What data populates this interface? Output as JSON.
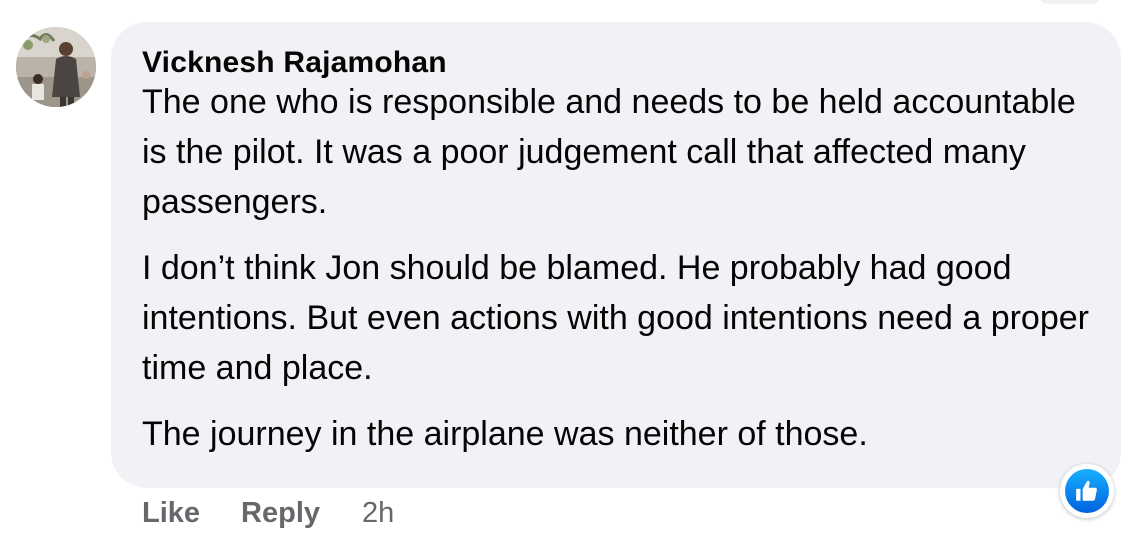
{
  "comment": {
    "author": "Vicknesh Rajamohan",
    "paragraphs": [
      "The one who is responsible and needs to be held accountable is the pilot. It was a poor judgement call that affected many passengers.",
      "I don’t think Jon should be blamed. He probably had good intentions. But even actions with good intentions need a proper time and place.",
      "The journey in the airplane was neither of those."
    ],
    "reaction_icon": "like-icon",
    "actions": {
      "like": "Like",
      "reply": "Reply",
      "timestamp": "2h"
    }
  },
  "colors": {
    "bubble_background": "#f0f2f5",
    "text": "#050505",
    "secondary_text": "#65676b",
    "like_blue": "#0866ff"
  }
}
